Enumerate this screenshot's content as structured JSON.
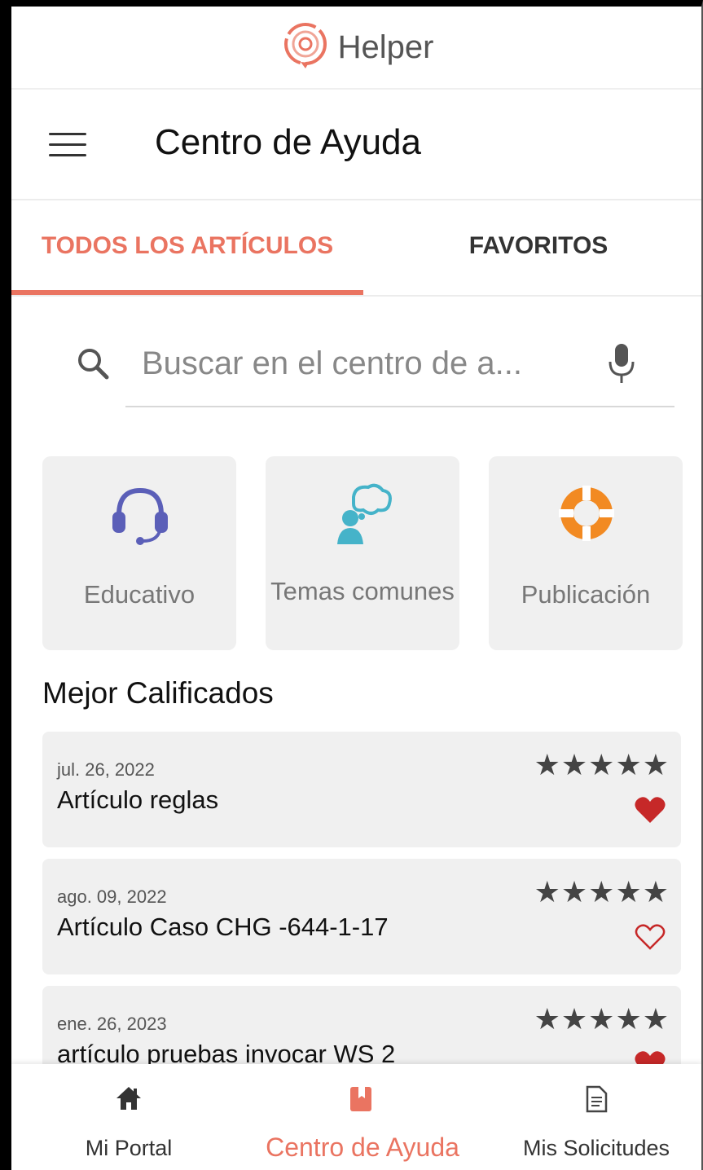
{
  "brand": {
    "name": "Helper",
    "logo_icon": "helper-logo-icon",
    "accent": "#ea7461"
  },
  "app_bar": {
    "title": "Centro de Ayuda",
    "menu_icon": "hamburger-menu-icon"
  },
  "tabs": [
    {
      "label": "TODOS LOS ARTÍCULOS",
      "active": true
    },
    {
      "label": "FAVORITOS",
      "active": false
    }
  ],
  "search": {
    "placeholder": "Buscar en el centro de a...",
    "value": ""
  },
  "categories": [
    {
      "label": "Educativo",
      "icon": "headset-icon",
      "color": "#5b5fb8"
    },
    {
      "label": "Temas comunes",
      "icon": "person-thought-icon",
      "color": "#45b3c9"
    },
    {
      "label": "Publicación",
      "icon": "lifebuoy-icon",
      "color": "#f28a22"
    }
  ],
  "best_rated": {
    "title": "Mejor Calificados",
    "articles": [
      {
        "date": "jul. 26, 2022",
        "title": "Artículo reglas",
        "stars": "★★★★★",
        "rating": 5,
        "favorite": true
      },
      {
        "date": "ago. 09, 2022",
        "title": "Artículo Caso CHG -644-1-17",
        "stars": "★★★★★",
        "rating": 5,
        "favorite": false
      },
      {
        "date": "ene. 26, 2023",
        "title": "artículo pruebas invocar WS 2",
        "stars": "★★★★★",
        "rating": 5,
        "favorite": true
      }
    ]
  },
  "bottom_nav": [
    {
      "label": "Mi Portal",
      "icon": "home-icon",
      "active": false
    },
    {
      "label": "Centro de Ayuda",
      "icon": "book-icon",
      "active": true
    },
    {
      "label": "Mis Solicitudes",
      "icon": "document-icon",
      "active": false
    }
  ],
  "colors": {
    "accent": "#ea7461",
    "heart": "#c62828",
    "card_bg": "#f0f0f0"
  }
}
